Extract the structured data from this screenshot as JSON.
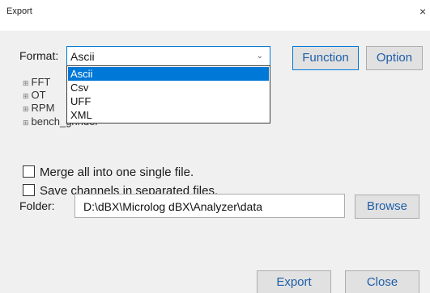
{
  "window": {
    "title": "Export",
    "close_glyph": "×"
  },
  "format": {
    "label": "Format:",
    "selected": "Ascii",
    "options": [
      "Ascii",
      "Csv",
      "UFF",
      "XML"
    ],
    "arrow_glyph": "⌄"
  },
  "buttons": {
    "function": "Function",
    "option": "Option",
    "browse": "Browse",
    "export": "Export",
    "close": "Close"
  },
  "tree": {
    "expander_glyph": "⊞",
    "items": [
      "FFT",
      "OT",
      "RPM",
      "bench_grinder"
    ]
  },
  "options": {
    "merge": "Merge all into one single file.",
    "separate": "Save channels in separated files."
  },
  "folder": {
    "label": "Folder:",
    "path": "D:\\dBX\\Microlog dBX\\Analyzer\\data"
  },
  "colors": {
    "accent": "#0078d7",
    "button_text": "#1f5ea8"
  }
}
